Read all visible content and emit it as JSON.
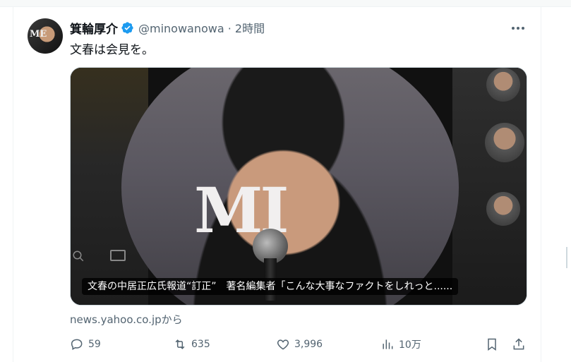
{
  "tweet": {
    "display_name": "箕輪厚介",
    "handle_time": "@minowanowa · 2時間",
    "text": "文春は会見を。",
    "avatar_letters": "ME"
  },
  "card": {
    "caption": "文春の中居正広氏報道“訂正”　著名編集者「こんな大事なファクトをしれっと......",
    "photo_letters": "MI",
    "source": "news.yahoo.co.jpから"
  },
  "actions": {
    "replies": "59",
    "retweets": "635",
    "likes": "3,996",
    "views": "10万"
  },
  "colors": {
    "verified": "#1d9bf0",
    "secondary_text": "#536471",
    "primary_text": "#0f1419"
  },
  "icons": [
    "verified-badge-icon",
    "more-icon",
    "reply-icon",
    "retweet-icon",
    "like-icon",
    "views-icon",
    "bookmark-icon",
    "share-icon"
  ]
}
